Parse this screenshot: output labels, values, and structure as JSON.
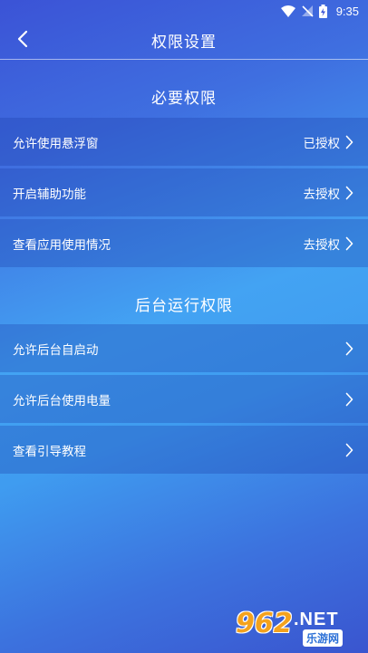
{
  "status_bar": {
    "time": "9:35"
  },
  "header": {
    "title": "权限设置"
  },
  "sections": [
    {
      "title": "必要权限",
      "items": [
        {
          "label": "允许使用悬浮窗",
          "status": "已授权"
        },
        {
          "label": "开启辅助功能",
          "status": "去授权"
        },
        {
          "label": "查看应用使用情况",
          "status": "去授权"
        }
      ]
    },
    {
      "title": "后台运行权限",
      "items": [
        {
          "label": "允许后台自启动",
          "status": ""
        },
        {
          "label": "允许后台使用电量",
          "status": ""
        },
        {
          "label": "查看引导教程",
          "status": ""
        }
      ]
    }
  ],
  "watermark": {
    "logo": "962",
    "domain": ".NET",
    "name": "乐游网"
  },
  "colors": {
    "accent_text": "#ffffff",
    "background_top": "#3b53d6",
    "background_mid": "#43a3f3",
    "background_bottom": "#3a55cf"
  }
}
